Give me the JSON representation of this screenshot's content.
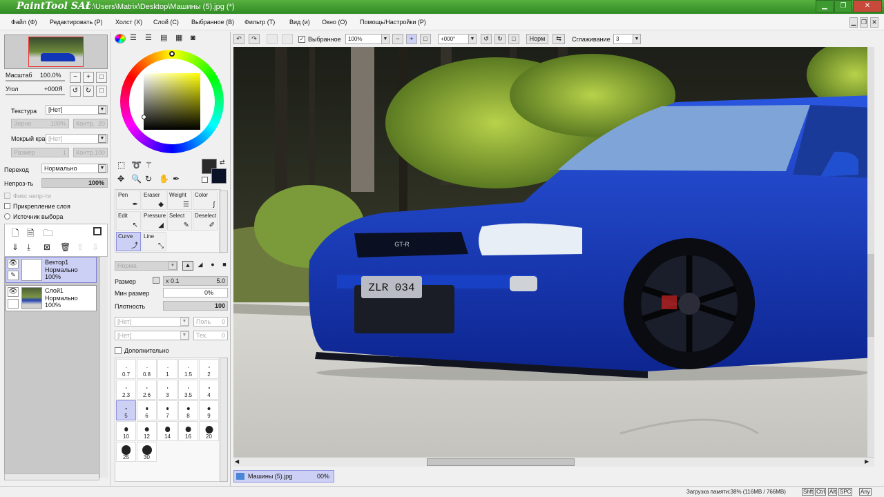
{
  "title": {
    "logo": "PaintTool SAI",
    "path": "C:\\Users\\Matrix\\Desktop\\Машины (5).jpg (*)"
  },
  "menu": [
    "Файл (Ф)",
    "Редактировать (Р)",
    "Холст (Х)",
    "Слой (С)",
    "Выбранное (В)",
    "Фильтр (Т)",
    "Вид (и)",
    "Окно (О)",
    "Помощь/Настройки (Р)"
  ],
  "toolbar": {
    "selection_label": "Выбранное",
    "zoom": "100%",
    "angle": "+000°",
    "mode": "Норм",
    "smoothing_label": "Сглаживание",
    "smoothing": "3"
  },
  "nav": {
    "zoom_label": "Масштаб",
    "zoom": "100.0%",
    "angle_label": "Угол",
    "angle": "+000Я"
  },
  "texture": {
    "label": "Текстура",
    "value": "[Нет]",
    "grain_label": "Зерно",
    "grain": "100%",
    "contrast_label": "Контр.",
    "contrast": "20"
  },
  "wet_edge": {
    "label": "Мокрый край",
    "value": "[Нет]",
    "size_label": "Размер",
    "size": "1",
    "contrast_label": "Контр.",
    "contrast": "100"
  },
  "blend": {
    "label": "Переход",
    "value": "Нормально",
    "opacity_label": "Непроз-ть",
    "opacity": "100%",
    "opacity_fraction": 1.0
  },
  "checks": {
    "fix_opacity": "Фикс непр-ти",
    "clip": "Прикрепление слоя",
    "source": "Источник выбора"
  },
  "layers": [
    {
      "name": "Вектор1",
      "mode": "Нормально",
      "opacity": "100%"
    },
    {
      "name": "Слой1",
      "mode": "Нормально",
      "opacity": "100%"
    }
  ],
  "tools": [
    {
      "label": "Pen",
      "icon": "pen-icon"
    },
    {
      "label": "Eraser",
      "icon": "eraser-icon"
    },
    {
      "label": "Weight",
      "icon": "weight-icon"
    },
    {
      "label": "Color",
      "icon": "color-icon"
    },
    {
      "label": "Edit",
      "icon": "edit-icon"
    },
    {
      "label": "Pressure",
      "icon": "pressure-icon"
    },
    {
      "label": "Select",
      "icon": "select-icon"
    },
    {
      "label": "Deselect",
      "icon": "deselect-icon"
    },
    {
      "label": "Curve",
      "icon": "curve-icon"
    },
    {
      "label": "Line",
      "icon": "line-icon"
    }
  ],
  "brush": {
    "mode": "Норма",
    "size_label": "Размер",
    "size_mult": "x 0.1",
    "size": "5.0",
    "min_size_label": "Мин размер",
    "min_size": "0%",
    "density_label": "Плотность",
    "density": "100",
    "shape": "[Нет]",
    "shape_value": "0",
    "texture": "[Нет]",
    "texture_value": "0",
    "extra_label": "Дополнительно",
    "shape_label": "Поль",
    "texture_label": "Тек."
  },
  "brush_sizes": [
    "0.7",
    "0.8",
    "1",
    "1.5",
    "2",
    "2.3",
    "2.6",
    "3",
    "3.5",
    "4",
    "5",
    "6",
    "7",
    "8",
    "9",
    "10",
    "12",
    "14",
    "16",
    "20",
    "25",
    "30"
  ],
  "doc_tab": {
    "name": "Машины (5).jpg",
    "zoom": "00%"
  },
  "status": {
    "memory": "Загрузка памяти:38% (116MB / 766MB)",
    "keys": [
      "Shft",
      "Ctrl",
      "Alt",
      "SPC",
      "Any"
    ]
  },
  "photo": {
    "plate": "ZLR 034",
    "badge": "GT-R"
  },
  "colors": {
    "accent": "#3d9a30",
    "primary": "#2a2a2a",
    "secondary": "#0a1228",
    "car": "#1236b8"
  }
}
